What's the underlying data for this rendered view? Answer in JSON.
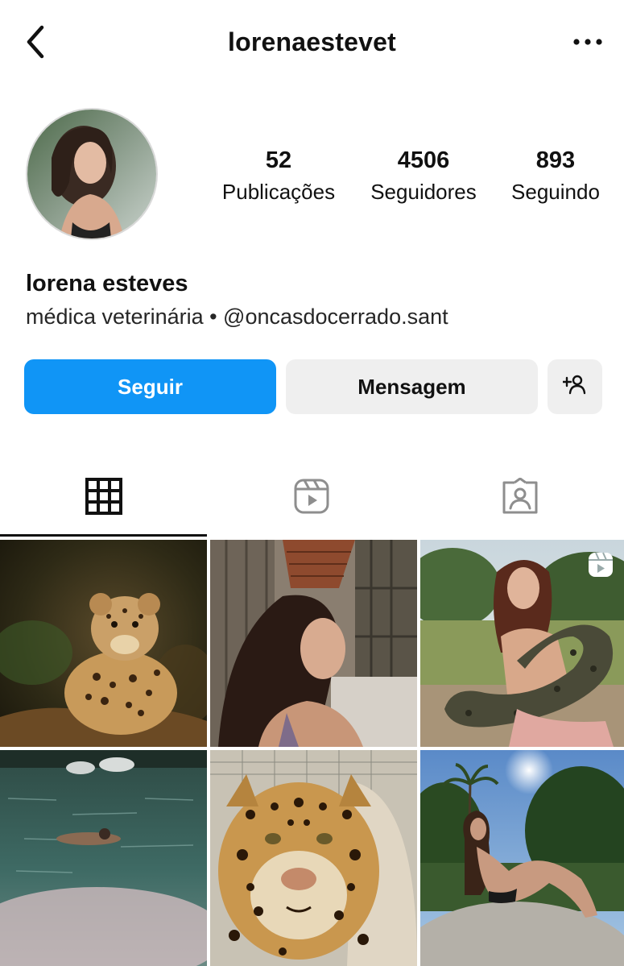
{
  "header": {
    "username": "lorenaestevet",
    "back_icon": "chevron-left-icon",
    "more_icon": "ellipsis-icon"
  },
  "profile": {
    "stats": {
      "posts": {
        "value": "52",
        "label": "Publicações"
      },
      "followers": {
        "value": "4506",
        "label": "Seguidores"
      },
      "following": {
        "value": "893",
        "label": "Seguindo"
      }
    },
    "full_name": "lorena esteves",
    "bio": "médica veterinária • @oncasdocerrado.sant"
  },
  "actions": {
    "follow_label": "Seguir",
    "message_label": "Mensagem",
    "add_user_icon": "add-person-icon"
  },
  "tabs": {
    "active": "grid",
    "items": [
      {
        "id": "grid",
        "icon": "grid-icon"
      },
      {
        "id": "reels",
        "icon": "reels-icon"
      },
      {
        "id": "tagged",
        "icon": "tagged-person-icon"
      }
    ]
  },
  "posts": [
    {
      "subject": "jaguar cub",
      "type": "photo"
    },
    {
      "subject": "woman portrait in barn",
      "type": "photo"
    },
    {
      "subject": "woman holding anaconda",
      "type": "reel"
    },
    {
      "subject": "swimmer in river",
      "type": "photo"
    },
    {
      "subject": "adult jaguar close-up",
      "type": "photo"
    },
    {
      "subject": "woman sitting on rock under palm trees",
      "type": "photo"
    }
  ],
  "colors": {
    "accent": "#1095f6",
    "secondary_button": "#efefef",
    "text": "#111111"
  }
}
